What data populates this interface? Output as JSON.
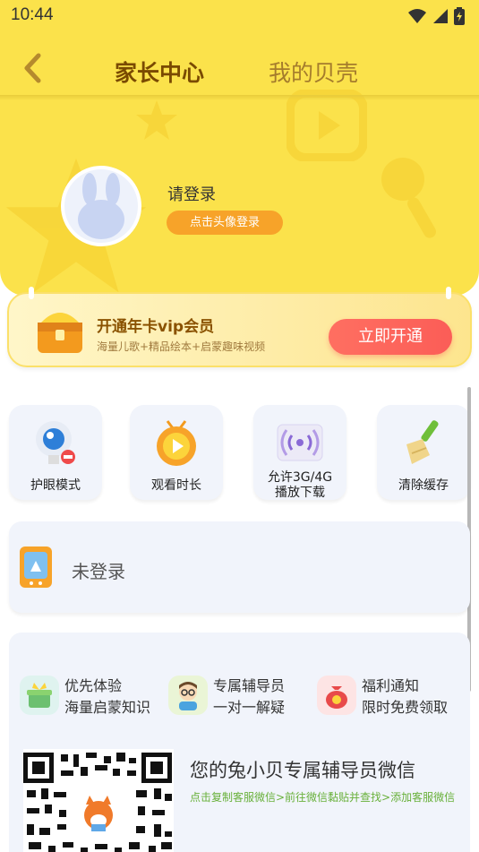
{
  "status_bar": {
    "time": "10:44"
  },
  "nav": {
    "active_tab": "家长中心",
    "inactive_tab": "我的贝壳"
  },
  "profile": {
    "login_text": "请登录",
    "login_button": "点击头像登录"
  },
  "vip": {
    "title": "开通年卡vip会员",
    "subtitle": "海量儿歌+精品绘本+启蒙趣味视频",
    "button": "立即开通"
  },
  "actions": [
    {
      "label": "护眼模式",
      "icon": "eye-protect-icon"
    },
    {
      "label": "观看时长",
      "icon": "tv-timer-icon"
    },
    {
      "label": "允许3G/4G",
      "label2": "播放下载",
      "icon": "signal-download-icon"
    },
    {
      "label": "清除缓存",
      "icon": "broom-icon"
    }
  ],
  "device_status": {
    "text": "未登录"
  },
  "features": [
    {
      "title": "优先体验",
      "desc": "海量启蒙知识",
      "icon": "gift-box-icon"
    },
    {
      "title": "专属辅导员",
      "desc": "一对一解疑",
      "icon": "tutor-icon"
    },
    {
      "title": "福利通知",
      "desc": "限时免费领取",
      "icon": "lucky-bag-icon"
    }
  ],
  "wechat": {
    "title": "您的兔小贝专属辅导员微信",
    "desc": "点击复制客服微信>前往微信黏贴并查找>添加客服微信"
  },
  "colors": {
    "header_yellow": "#fbe24b",
    "vip_button": "#fb5d57",
    "login_button": "#f7a329",
    "wechat_desc": "#68b03a"
  }
}
